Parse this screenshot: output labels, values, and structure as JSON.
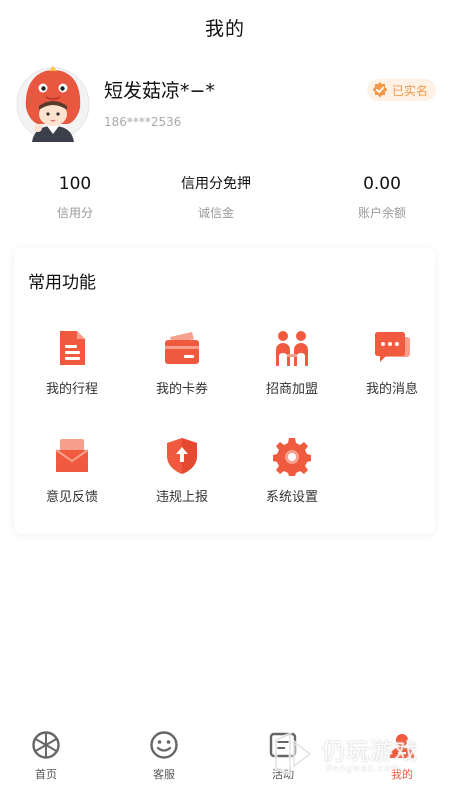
{
  "header": {
    "title": "我的"
  },
  "profile": {
    "nickname": "短发菇凉*−*",
    "phone": "186****2536",
    "verified_label": "已实名"
  },
  "stats": [
    {
      "value": "100",
      "label": "信用分"
    },
    {
      "value": "信用分免押",
      "label": "诚信金"
    },
    {
      "value": "0.00",
      "label": "账户余额"
    }
  ],
  "functions": {
    "title": "常用功能",
    "items": [
      {
        "label": "我的行程",
        "icon": "trip-document-icon"
      },
      {
        "label": "我的卡券",
        "icon": "coupon-card-icon"
      },
      {
        "label": "招商加盟",
        "icon": "people-join-icon"
      },
      {
        "label": "我的消息",
        "icon": "message-bubble-icon"
      },
      {
        "label": "意见反馈",
        "icon": "feedback-envelope-icon"
      },
      {
        "label": "违规上报",
        "icon": "report-shield-icon"
      },
      {
        "label": "系统设置",
        "icon": "settings-gear-icon"
      }
    ]
  },
  "tabbar": {
    "active": "我的",
    "items": [
      {
        "label": "首页",
        "icon": "home-wheel-icon"
      },
      {
        "label": "客服",
        "icon": "service-smile-icon"
      },
      {
        "label": "活动",
        "icon": "activity-icon"
      },
      {
        "label": "我的",
        "icon": "profile-icon"
      }
    ]
  },
  "watermark": {
    "text": "仍玩游戏",
    "subtext": "Rengwan.com"
  },
  "colors": {
    "accent": "#f05a3e",
    "badge_bg": "#fff1e6",
    "badge_text": "#f29a4a",
    "muted_text": "#999999"
  }
}
